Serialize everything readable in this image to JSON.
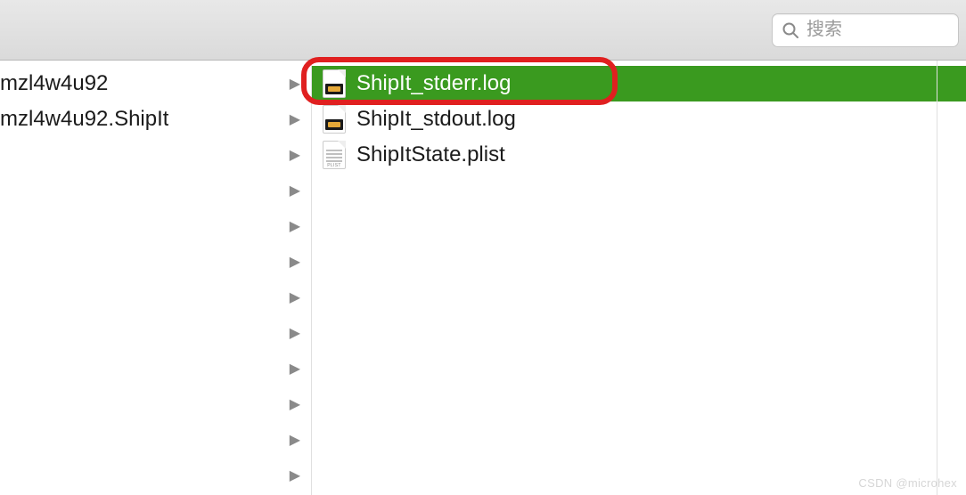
{
  "toolbar": {
    "search_placeholder": "搜索"
  },
  "left_column": {
    "items": [
      {
        "label": "mzl4w4u92"
      },
      {
        "label": "mzl4w4u92.ShipIt"
      }
    ],
    "empty_arrow_count": 10
  },
  "right_column": {
    "files": [
      {
        "name": "ShipIt_stderr.log",
        "type": "log",
        "selected": true
      },
      {
        "name": "ShipIt_stdout.log",
        "type": "log",
        "selected": false
      },
      {
        "name": "ShipItState.plist",
        "type": "plist",
        "selected": false
      }
    ]
  },
  "annotation": {
    "highlight_target": "ShipIt_stderr.log"
  },
  "watermark": "CSDN @microhex"
}
